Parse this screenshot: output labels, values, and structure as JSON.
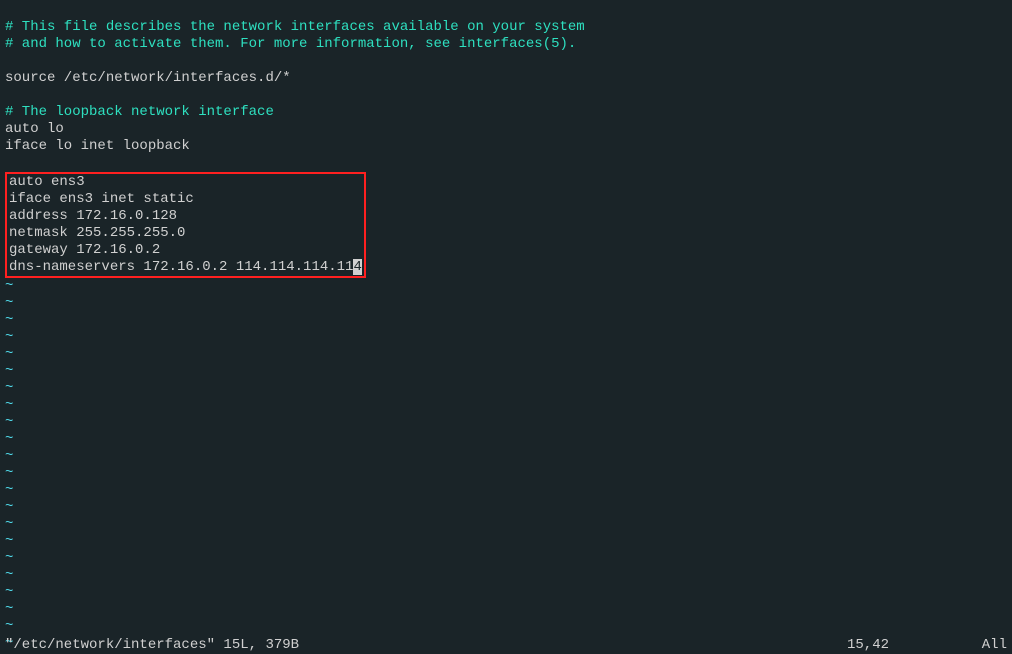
{
  "lines": {
    "comment1": "# This file describes the network interfaces available on your system",
    "comment2": "# and how to activate them. For more information, see interfaces(5).",
    "source": "source /etc/network/interfaces.d/*",
    "comment3": "# The loopback network interface",
    "auto_lo": "auto lo",
    "iface_lo": "iface lo inet loopback",
    "box": {
      "l1": "auto ens3",
      "l2": "iface ens3 inet static",
      "l3": "address 172.16.0.128",
      "l4": "netmask 255.255.255.0",
      "l5": "gateway 172.16.0.2",
      "l6_pre": "dns-nameservers 172.16.0.2 114.114.114.11",
      "l6_cursor": "4"
    }
  },
  "tilde": "~",
  "status": {
    "filename": "\"/etc/network/interfaces\" 15L, 379B",
    "position": "15,42",
    "percent": "All"
  }
}
